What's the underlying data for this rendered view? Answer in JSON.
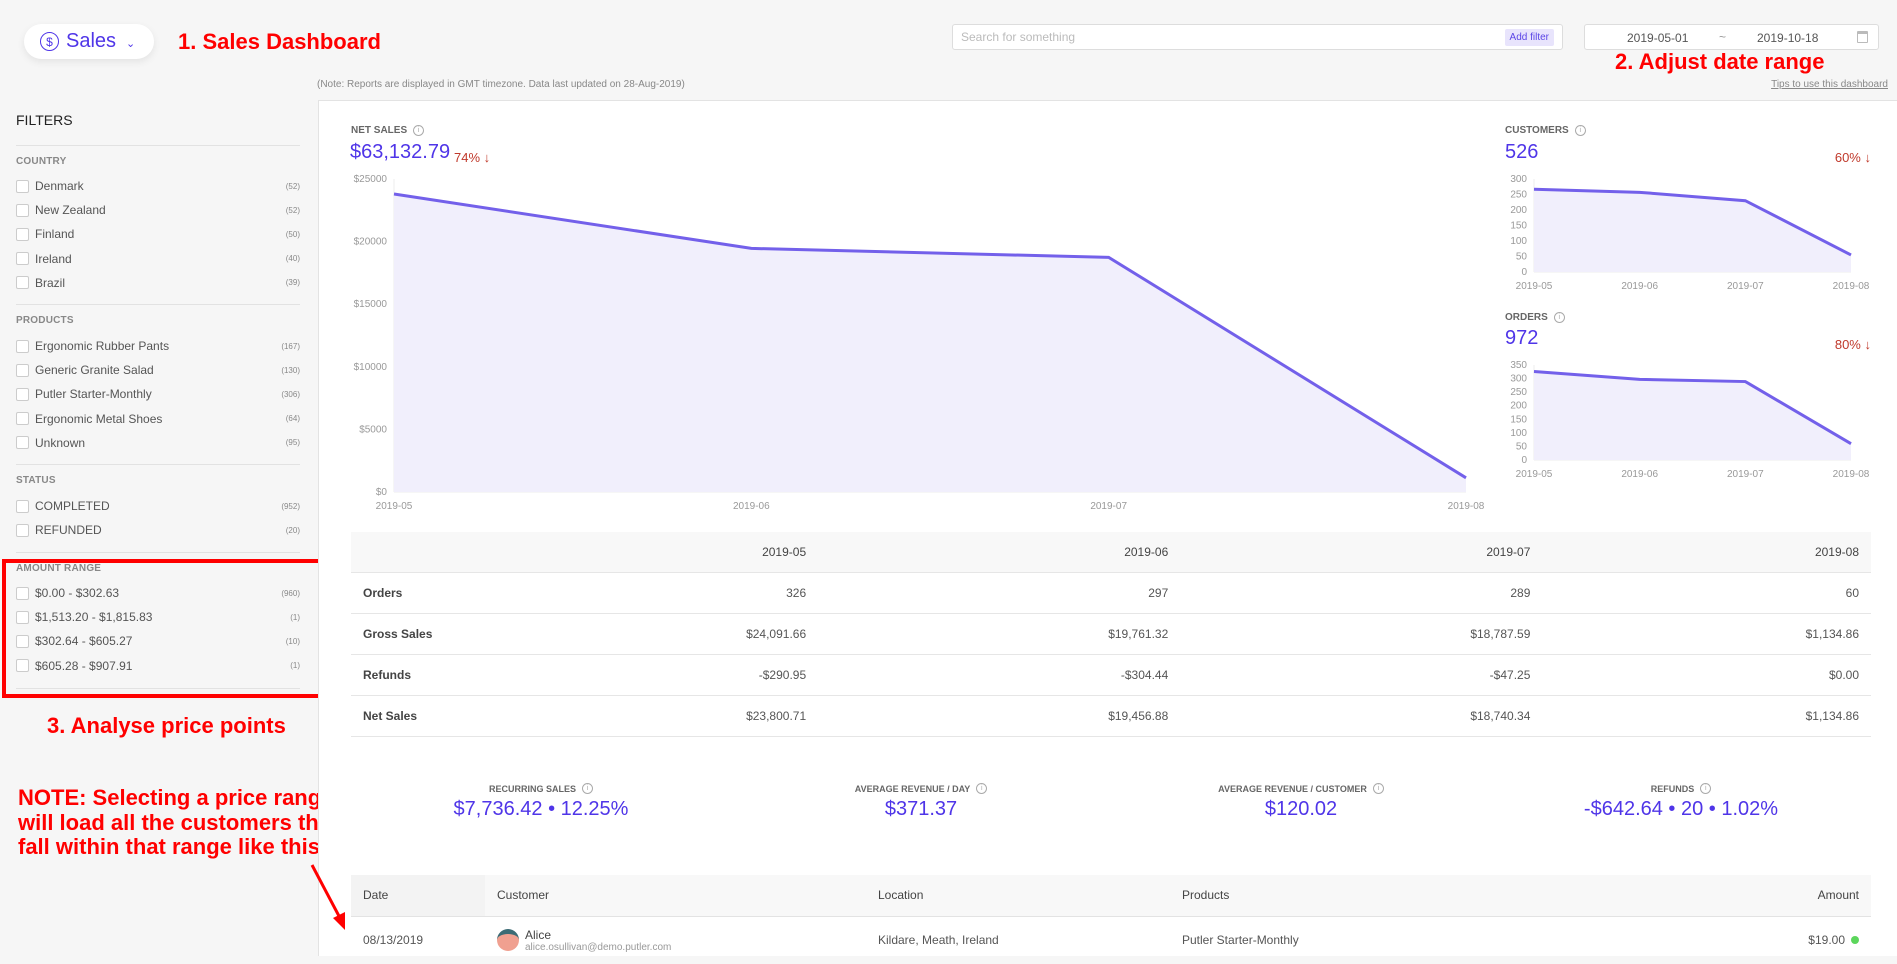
{
  "header": {
    "app_menu": "Sales",
    "app_icon": "dollar-circle-icon",
    "search_placeholder": "Search for something",
    "add_filter": "Add filter",
    "date_from": "2019-05-01",
    "date_sep": "~",
    "date_to": "2019-10-18",
    "note": "(Note: Reports are displayed in GMT timezone. Data last updated on 28-Aug-2019)",
    "tips": "Tips to use this dashboard"
  },
  "annotations": {
    "a1": "1. Sales Dashboard",
    "a2": "2. Adjust date range",
    "a3": "3. Analyse price points",
    "note_lines": [
      "NOTE: Selecting a price range",
      "will load all the customers that",
      "fall within that range like this"
    ],
    "color": "#ff0000"
  },
  "filters": {
    "title": "FILTERS",
    "sections": [
      {
        "heading": "COUNTRY",
        "items": [
          {
            "label": "Denmark",
            "count": "(52)"
          },
          {
            "label": "New Zealand",
            "count": "(52)"
          },
          {
            "label": "Finland",
            "count": "(50)"
          },
          {
            "label": "Ireland",
            "count": "(40)"
          },
          {
            "label": "Brazil",
            "count": "(39)"
          }
        ]
      },
      {
        "heading": "PRODUCTS",
        "items": [
          {
            "label": "Ergonomic Rubber Pants",
            "count": "(167)"
          },
          {
            "label": "Generic Granite Salad",
            "count": "(130)"
          },
          {
            "label": "Putler Starter-Monthly",
            "count": "(306)"
          },
          {
            "label": "Ergonomic Metal Shoes",
            "count": "(64)"
          },
          {
            "label": "Unknown",
            "count": "(95)"
          }
        ]
      },
      {
        "heading": "STATUS",
        "items": [
          {
            "label": "COMPLETED",
            "count": "(952)"
          },
          {
            "label": "REFUNDED",
            "count": "(20)"
          }
        ]
      },
      {
        "heading": "AMOUNT RANGE",
        "items": [
          {
            "label": "$0.00 - $302.63",
            "count": "(960)"
          },
          {
            "label": "$1,513.20 - $1,815.83",
            "count": "(1)"
          },
          {
            "label": "$302.64 - $605.27",
            "count": "(10)"
          },
          {
            "label": "$605.28 - $907.91",
            "count": "(1)"
          }
        ]
      }
    ]
  },
  "kpis": {
    "net_sales": {
      "label": "NET SALES",
      "value": "$63,132.79",
      "change": "74%"
    },
    "customers": {
      "label": "CUSTOMERS",
      "value": "526",
      "change": "60%"
    },
    "orders": {
      "label": "ORDERS",
      "value": "972",
      "change": "80%"
    }
  },
  "colors": {
    "accent": "#4f35e8",
    "line": "#7360ea",
    "fill": "#f1effc",
    "negative": "#c0392b",
    "status_ok": "#5cd65c"
  },
  "chart_data": [
    {
      "type": "area",
      "categories": [
        "2019-05",
        "2019-06",
        "2019-07",
        "2019-08"
      ],
      "values": [
        23800.71,
        19456.88,
        18740.34,
        1134.86
      ],
      "ylim": [
        0,
        25000
      ],
      "yticks": [
        "$0",
        "$5000",
        "$10000",
        "$15000",
        "$20000",
        "$25000"
      ],
      "ytick_values": [
        0,
        5000,
        10000,
        15000,
        20000,
        25000
      ]
    },
    {
      "type": "area",
      "categories": [
        "2019-05",
        "2019-06",
        "2019-07",
        "2019-08"
      ],
      "values": [
        267,
        257,
        230,
        55
      ],
      "ylim": [
        0,
        300
      ],
      "yticks": [
        "0",
        "50",
        "100",
        "150",
        "200",
        "250",
        "300"
      ],
      "ytick_values": [
        0,
        50,
        100,
        150,
        200,
        250,
        300
      ]
    },
    {
      "type": "area",
      "categories": [
        "2019-05",
        "2019-06",
        "2019-07",
        "2019-08"
      ],
      "values": [
        326,
        297,
        289,
        60
      ],
      "ylim": [
        0,
        350
      ],
      "yticks": [
        "0",
        "50",
        "100",
        "150",
        "200",
        "250",
        "300",
        "350"
      ],
      "ytick_values": [
        0,
        50,
        100,
        150,
        200,
        250,
        300,
        350
      ]
    }
  ],
  "summary_table": {
    "columns": [
      "2019-05",
      "2019-06",
      "2019-07",
      "2019-08"
    ],
    "rows": [
      {
        "label": "Orders",
        "values": [
          "326",
          "297",
          "289",
          "60"
        ]
      },
      {
        "label": "Gross Sales",
        "values": [
          "$24,091.66",
          "$19,761.32",
          "$18,787.59",
          "$1,134.86"
        ]
      },
      {
        "label": "Refunds",
        "values": [
          "-$290.95",
          "-$304.44",
          "-$47.25",
          "$0.00"
        ]
      },
      {
        "label": "Net Sales",
        "values": [
          "$23,800.71",
          "$19,456.88",
          "$18,740.34",
          "$1,134.86"
        ]
      }
    ]
  },
  "stats": [
    {
      "label": "RECURRING SALES",
      "value": "$7,736.42 • 12.25%"
    },
    {
      "label": "AVERAGE REVENUE / DAY",
      "value": "$371.37"
    },
    {
      "label": "AVERAGE REVENUE / CUSTOMER",
      "value": "$120.02"
    },
    {
      "label": "REFUNDS",
      "value": "-$642.64 • 20 • 1.02%"
    }
  ],
  "orders_table": {
    "columns": [
      "Date",
      "Customer",
      "Location",
      "Products",
      "Amount"
    ],
    "rows": [
      {
        "date": "08/13/2019",
        "name": "Alice",
        "email": "alice.osullivan@demo.putler.com",
        "location": "Kildare, Meath, Ireland",
        "product": "Putler Starter-Monthly",
        "amount": "$19.00"
      }
    ]
  }
}
